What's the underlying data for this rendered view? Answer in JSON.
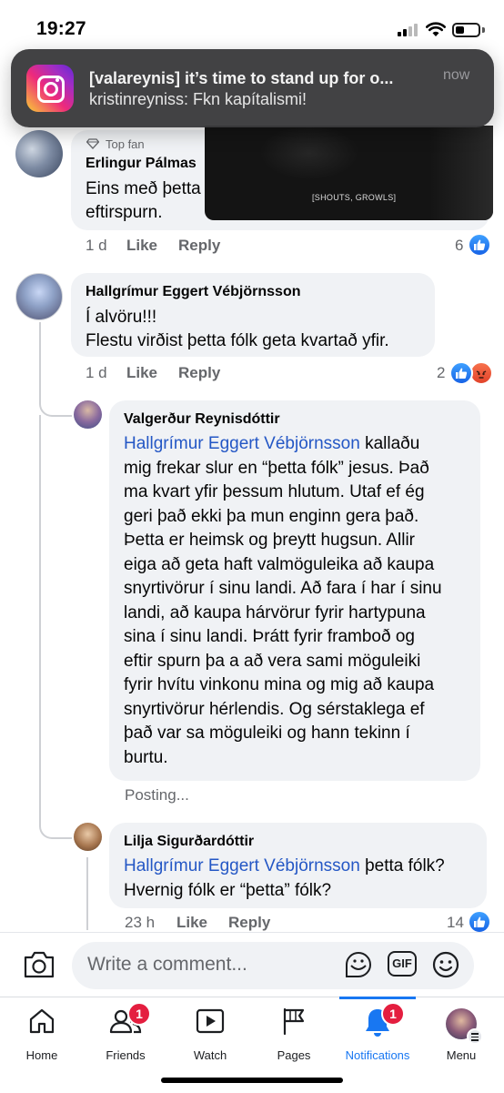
{
  "status_bar": {
    "time": "19:27"
  },
  "notification": {
    "app_icon": "instagram-icon",
    "title": "[valareynis] it’s time to stand up for o...",
    "body": "kristinreyniss: Fkn kapítalismi!",
    "time": "now"
  },
  "video": {
    "caption": "[SHOUTS, GROWLS]"
  },
  "comments": [
    {
      "badge": "Top fan",
      "author": "Erlingur Pálmas",
      "lines": [
        "Eins með þetta",
        "eftirspurn."
      ],
      "time": "1 d",
      "like_label": "Like",
      "reply_label": "Reply",
      "reaction_count": "6"
    },
    {
      "author": "Hallgrímur Eggert Vébjörnsson",
      "lines": [
        "Í alvöru!!!",
        "Flestu virðist þetta fólk geta kvartað yfir."
      ],
      "time": "1 d",
      "like_label": "Like",
      "reply_label": "Reply",
      "reaction_count": "2"
    },
    {
      "author": "Valgerður Reynisdóttir",
      "mention": "Hallgrímur Eggert Vébjörnsson",
      "first_line_rest": " kallaðu",
      "lines": [
        "mig frekar slur en “þetta fólk” jesus. Það",
        "ma kvart yfir þessum hlutum. Utaf ef ég",
        "geri það ekki þa mun enginn gera það.",
        "Þetta er heimsk og þreytt hugsun. Allir",
        "eiga að geta haft valmöguleika að kaupa",
        "snyrtivörur í sinu landi. Að fara í har í sinu",
        "landi, að kaupa hárvörur fyrir hartypuna",
        "sina í sinu landi. Þrátt fyrir framboð og",
        "eftir spurn þa a að vera sami möguleiki",
        "fyrir hvítu vinkonu mina og mig að kaupa",
        "snyrtivörur hérlendis. Og sérstaklega ef",
        "það var sa möguleiki og hann tekinn í",
        "burtu."
      ],
      "status": "Posting..."
    },
    {
      "author": "Lilja Sigurðardóttir",
      "mention": "Hallgrímur Eggert Vébjörnsson",
      "first_line_rest": " þetta fólk?",
      "lines": [
        "Hvernig fólk er “þetta” fólk?"
      ],
      "time": "23 h",
      "like_label": "Like",
      "reply_label": "Reply",
      "reaction_count": "14"
    }
  ],
  "composer": {
    "placeholder": "Write a comment...",
    "gif_label": "GIF"
  },
  "tabs": [
    {
      "label": "Home",
      "icon": "home-icon"
    },
    {
      "label": "Friends",
      "icon": "friends-icon",
      "badge": "1"
    },
    {
      "label": "Watch",
      "icon": "watch-icon"
    },
    {
      "label": "Pages",
      "icon": "pages-flag-icon"
    },
    {
      "label": "Notifications",
      "icon": "bell-icon",
      "badge": "1",
      "active": true
    },
    {
      "label": "Menu",
      "icon": "profile-avatar"
    }
  ],
  "colors": {
    "accent": "#1877f2",
    "mention": "#2457c5",
    "badge": "#e41e3f",
    "bubble": "#f0f2f5"
  }
}
